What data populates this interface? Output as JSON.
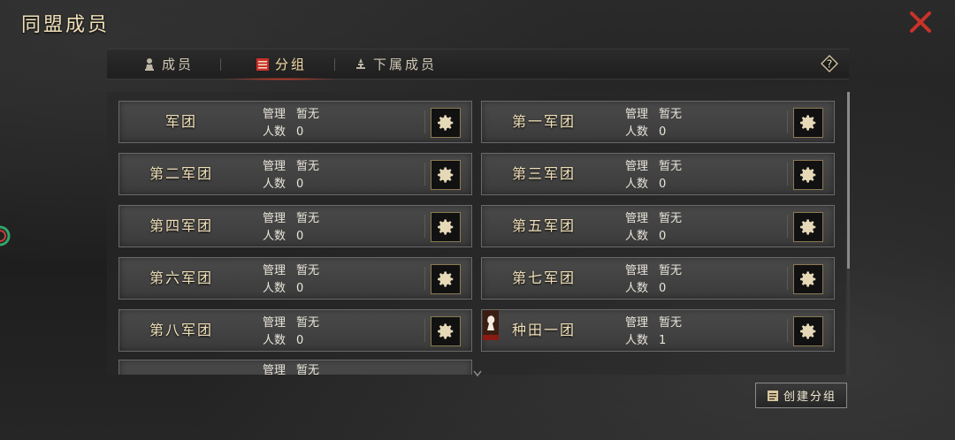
{
  "title": "同盟成员",
  "tabs": [
    {
      "label": "成员",
      "icon": "chess-pawn-icon",
      "active": false
    },
    {
      "label": "分组",
      "icon": "group-list-icon",
      "active": true
    },
    {
      "label": "下属成员",
      "icon": "tower-icon",
      "active": false
    }
  ],
  "labels": {
    "manage": "管理",
    "count": "人数"
  },
  "groups": [
    {
      "name": "军团",
      "manager": "暂无",
      "count": "0"
    },
    {
      "name": "第一军团",
      "manager": "暂无",
      "count": "0"
    },
    {
      "name": "第二军团",
      "manager": "暂无",
      "count": "0"
    },
    {
      "name": "第三军团",
      "manager": "暂无",
      "count": "0"
    },
    {
      "name": "第四军团",
      "manager": "暂无",
      "count": "0"
    },
    {
      "name": "第五军团",
      "manager": "暂无",
      "count": "0"
    },
    {
      "name": "第六军团",
      "manager": "暂无",
      "count": "0"
    },
    {
      "name": "第七军团",
      "manager": "暂无",
      "count": "0"
    },
    {
      "name": "第八军团",
      "manager": "暂无",
      "count": "0"
    },
    {
      "name": "种田一团",
      "manager": "暂无",
      "count": "1",
      "has_avatar": true
    },
    {
      "name": "",
      "manager": "暂无",
      "count": ""
    }
  ],
  "create_button": "创建分组",
  "colors": {
    "accent_gold": "#f0e0b8",
    "close_red": "#c8332a",
    "active_tab_glow": "#d2402a"
  }
}
